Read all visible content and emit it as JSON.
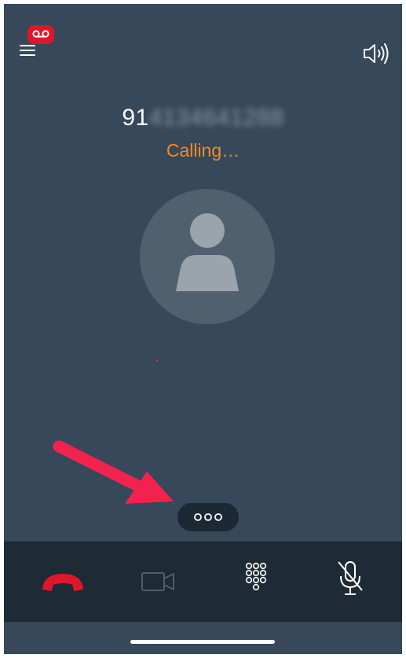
{
  "call": {
    "number_prefix": "91",
    "number_hidden": "4134641288",
    "status": "Calling…"
  },
  "top_bar": {
    "menu_icon": "menu-icon",
    "voicemail_icon": "voicemail-icon",
    "speaker_icon": "speaker-icon"
  },
  "more_button": {
    "icon": "more-horizontal-icon"
  },
  "controls": [
    {
      "name": "end-call",
      "icon": "phone-hangup-icon",
      "color": "#e0162b",
      "enabled": true
    },
    {
      "name": "video",
      "icon": "video-camera-icon",
      "color": "#4f5e6b",
      "enabled": false
    },
    {
      "name": "keypad",
      "icon": "dialpad-icon",
      "color": "#ffffff",
      "enabled": true
    },
    {
      "name": "mute",
      "icon": "microphone-muted-icon",
      "color": "#ffffff",
      "enabled": true
    }
  ],
  "colors": {
    "background": "#36485a",
    "accent_status": "#f28a25",
    "badge": "#e0162b",
    "annotation_arrow": "#f2224e",
    "control_bar": "#1e2a35"
  }
}
